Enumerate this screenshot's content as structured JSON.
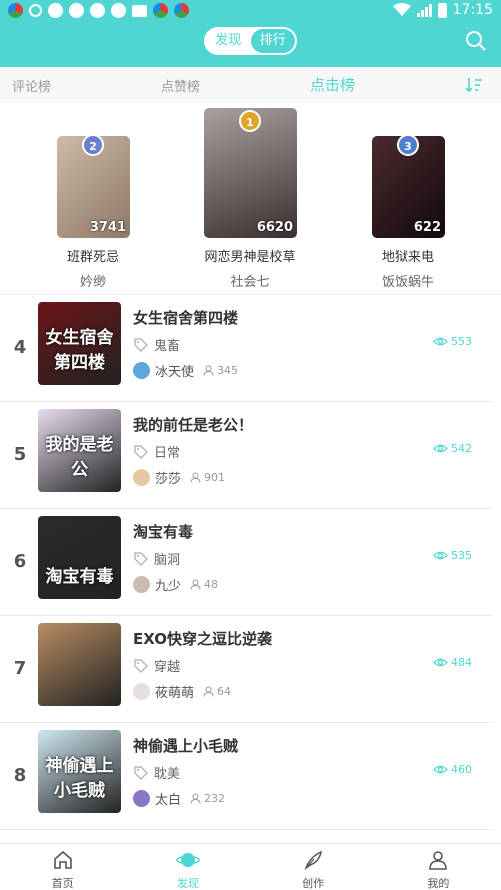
{
  "status": {
    "time": "17:15"
  },
  "header": {
    "tabs": [
      {
        "label": "发现"
      },
      {
        "label": "排行"
      }
    ]
  },
  "rank_tabs": [
    {
      "label": "评论榜"
    },
    {
      "label": "点赞榜"
    },
    {
      "label": "点击榜"
    }
  ],
  "podium": [
    {
      "rank": "1",
      "title": "网恋男神是校草",
      "author": "社会七",
      "count": "6620",
      "color": "#7a6a66"
    },
    {
      "rank": "2",
      "title": "班群死忌",
      "author": "妗缈",
      "count": "3741",
      "color": "#b9a48f"
    },
    {
      "rank": "3",
      "title": "地狱来电",
      "author": "饭饭蜗牛",
      "count": "622",
      "color": "#3b2227"
    }
  ],
  "list": [
    {
      "rank": "4",
      "title": "女生宿舍第四楼",
      "tag": "鬼畜",
      "user": "冰天使",
      "fans": "345",
      "views": "553",
      "cover_text": "女生宿舍第四楼",
      "cover_color": "#6b1518",
      "avatar_color": "#5ba7d8"
    },
    {
      "rank": "5",
      "title": "我的前任是老公！",
      "tag": "日常",
      "user": "莎莎",
      "fans": "901",
      "views": "542",
      "cover_text": "我的是老公",
      "cover_color": "#e7dcee",
      "avatar_color": "#e4c9a0"
    },
    {
      "rank": "6",
      "title": "淘宝有毒",
      "tag": "脑洞",
      "user": "九少",
      "fans": "48",
      "views": "535",
      "cover_text": "淘宝有毒",
      "cover_color": "#2b2b2b",
      "avatar_color": "#cdbab0"
    },
    {
      "rank": "7",
      "title": "EXO快穿之逗比逆袭",
      "tag": "穿越",
      "user": "莜萌萌",
      "fans": "64",
      "views": "484",
      "cover_text": "",
      "cover_color": "#b88d62",
      "avatar_color": "#e6e0dc"
    },
    {
      "rank": "8",
      "title": "神偷遇上小毛贼",
      "tag": "耽美",
      "user": "太白",
      "fans": "232",
      "views": "460",
      "cover_text": "神偷遇上小毛贼",
      "cover_color": "#cfe7f2",
      "avatar_color": "#8a75c7"
    }
  ],
  "bottom_nav": [
    {
      "label": "首页"
    },
    {
      "label": "发现"
    },
    {
      "label": "创作"
    },
    {
      "label": "我的"
    }
  ],
  "colors": {
    "accent": "#4fd6d3",
    "gold": "#e0a528",
    "silver": "#6b7fcf",
    "bronze": "#4d7fd0"
  }
}
